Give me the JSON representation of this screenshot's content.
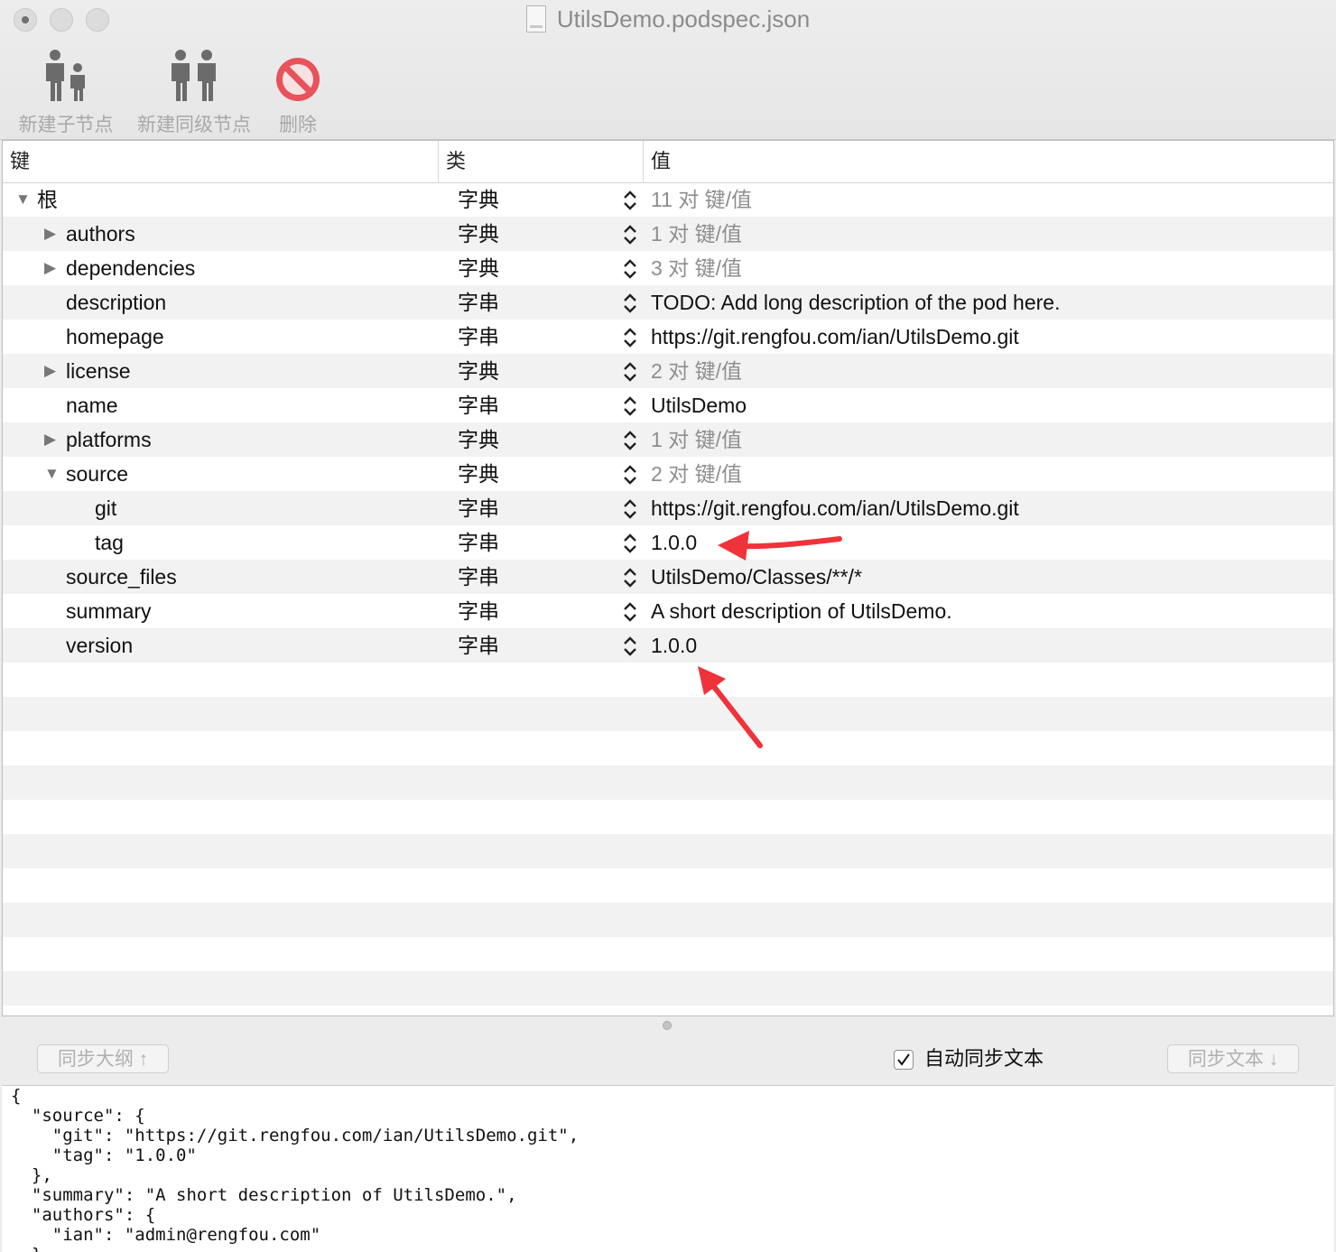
{
  "window": {
    "title": "UtilsDemo.podspec.json",
    "file_icon_label": "PLIST"
  },
  "toolbar": {
    "new_child_label": "新建子节点",
    "new_sibling_label": "新建同级节点",
    "delete_label": "删除"
  },
  "table": {
    "headers": {
      "key": "键",
      "type": "类",
      "value": "值"
    },
    "rows": [
      {
        "key": "根",
        "type": "字典",
        "value": "11 对 键/值",
        "level": 0,
        "disclosure": "expanded",
        "muted": true
      },
      {
        "key": "authors",
        "type": "字典",
        "value": "1 对 键/值",
        "level": 1,
        "disclosure": "collapsed",
        "muted": true
      },
      {
        "key": "dependencies",
        "type": "字典",
        "value": "3 对 键/值",
        "level": 1,
        "disclosure": "collapsed",
        "muted": true
      },
      {
        "key": "description",
        "type": "字串",
        "value": "TODO: Add long description of the pod here.",
        "level": 1,
        "disclosure": "none",
        "muted": false
      },
      {
        "key": "homepage",
        "type": "字串",
        "value": "https://git.rengfou.com/ian/UtilsDemo.git",
        "level": 1,
        "disclosure": "none",
        "muted": false
      },
      {
        "key": "license",
        "type": "字典",
        "value": "2 对 键/值",
        "level": 1,
        "disclosure": "collapsed",
        "muted": true
      },
      {
        "key": "name",
        "type": "字串",
        "value": "UtilsDemo",
        "level": 1,
        "disclosure": "none",
        "muted": false
      },
      {
        "key": "platforms",
        "type": "字典",
        "value": "1 对 键/值",
        "level": 1,
        "disclosure": "collapsed",
        "muted": true
      },
      {
        "key": "source",
        "type": "字典",
        "value": "2 对 键/值",
        "level": 1,
        "disclosure": "expanded",
        "muted": true
      },
      {
        "key": "git",
        "type": "字串",
        "value": "https://git.rengfou.com/ian/UtilsDemo.git",
        "level": 2,
        "disclosure": "none",
        "muted": false
      },
      {
        "key": "tag",
        "type": "字串",
        "value": "1.0.0",
        "level": 2,
        "disclosure": "none",
        "muted": false
      },
      {
        "key": "source_files",
        "type": "字串",
        "value": "UtilsDemo/Classes/**/*",
        "level": 1,
        "disclosure": "none",
        "muted": false
      },
      {
        "key": "summary",
        "type": "字串",
        "value": "A short description of UtilsDemo.",
        "level": 1,
        "disclosure": "none",
        "muted": false
      },
      {
        "key": "version",
        "type": "字串",
        "value": "1.0.0",
        "level": 1,
        "disclosure": "none",
        "muted": false
      }
    ]
  },
  "sync": {
    "sync_outline_label": "同步大纲 ↑",
    "auto_sync_label": "自动同步文本",
    "auto_sync_checked": true,
    "sync_text_label": "同步文本 ↓"
  },
  "editor": {
    "lines": [
      "{",
      "  \"source\": {",
      "    \"git\": \"https://git.rengfou.com/ian/UtilsDemo.git\",",
      "    \"tag\": \"1.0.0\"",
      "  },",
      "  \"summary\": \"A short description of UtilsDemo.\",",
      "  \"authors\": {",
      "    \"ian\": \"admin@rengfou.com\"",
      "  },"
    ]
  },
  "colors": {
    "annotation_arrow": "#f0323b",
    "delete_icon": "#e8525a",
    "muted_value": "#8e8e8e",
    "alt_row": "#f2f2f2"
  }
}
